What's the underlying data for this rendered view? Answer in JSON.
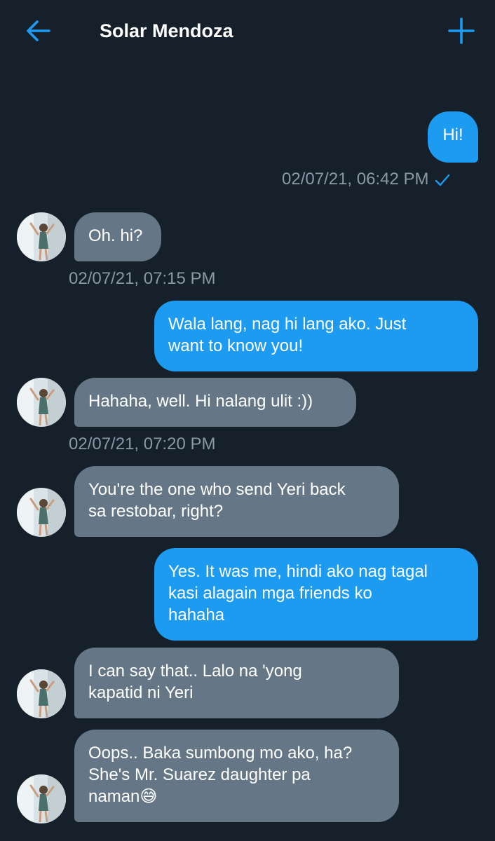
{
  "header": {
    "title": "Solar Mendoza",
    "back_icon": "arrow-left-icon",
    "add_icon": "plus-icon",
    "accent": "#1d9bf0"
  },
  "colors": {
    "background": "#15202b",
    "outgoing_bubble": "#1d9bf0",
    "incoming_bubble": "#657786",
    "timestamp": "#8899a6"
  },
  "messages": [
    {
      "direction": "out",
      "text": "Hi!"
    },
    {
      "direction": "meta",
      "text": "02/07/21, 06:42 PM",
      "icon": "read-check-icon"
    },
    {
      "direction": "in",
      "text": "Oh. hi?"
    },
    {
      "direction": "meta",
      "text": "02/07/21, 07:15 PM"
    },
    {
      "direction": "out",
      "text": "Wala lang, nag hi lang ako. Just\nwant to know you!"
    },
    {
      "direction": "in",
      "text": "Hahaha, well. Hi nalang ulit :))"
    },
    {
      "direction": "meta",
      "text": "02/07/21, 07:20 PM"
    },
    {
      "direction": "in",
      "text": "You're the one who send Yeri back\nsa restobar, right?"
    },
    {
      "direction": "out",
      "text": "Yes. It was me, hindi ako nag tagal\nkasi alagain mga friends ko\nhahaha"
    },
    {
      "direction": "in",
      "text": "I can say that.. Lalo na 'yong\nkapatid ni Yeri"
    },
    {
      "direction": "in",
      "text": "Oops.. Baka sumbong mo ako, ha?\nShe's Mr. Suarez daughter pa\nnaman😅"
    }
  ]
}
